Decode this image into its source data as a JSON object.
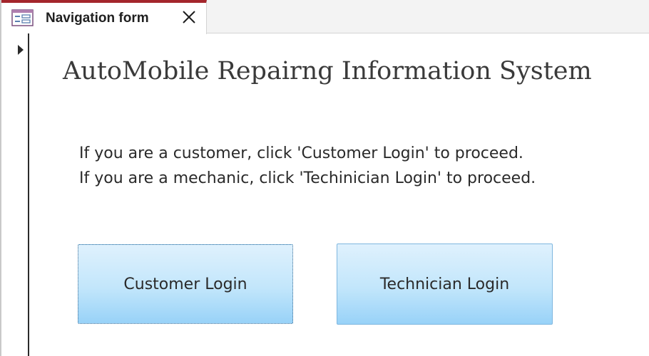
{
  "tab": {
    "title": "Navigation form",
    "icon": "form-icon",
    "close_icon": "close-icon",
    "accent_color": "#a4262c"
  },
  "form": {
    "title": "AutoMobile Repairng Information System",
    "instructions": [
      "If you are a customer, click 'Customer Login' to proceed.",
      "If you are a mechanic, click 'Techinician Login' to proceed."
    ],
    "buttons": {
      "customer_label": "Customer Login",
      "technician_label": "Technician Login"
    },
    "button_gradient": [
      "#dff1fd",
      "#98d2f8"
    ]
  },
  "record_selector_icon": "record-pointer-icon"
}
